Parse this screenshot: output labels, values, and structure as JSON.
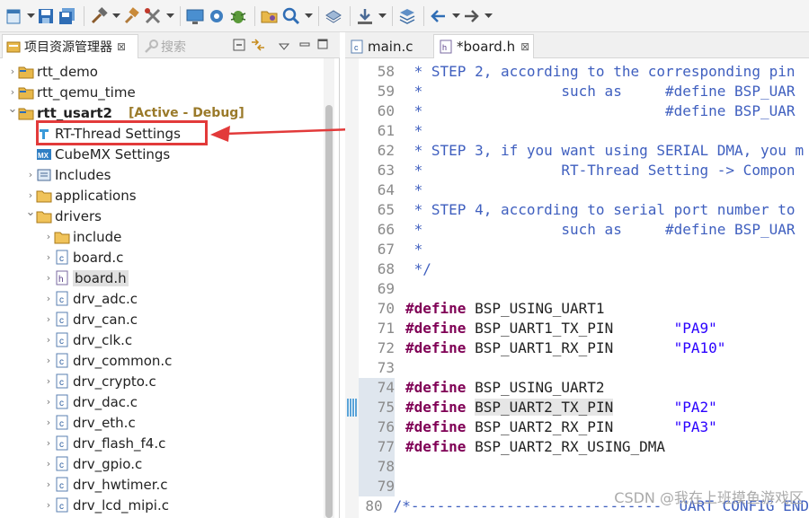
{
  "toolbar": {
    "icons": [
      "new-icon",
      "save-icon",
      "save-all-icon",
      "build-icon",
      "hammer-icon",
      "tools-icon",
      "monitor-icon",
      "gear-icon",
      "debug-bug-icon",
      "open-folder-icon",
      "search-icon",
      "layers-icon",
      "download-icon",
      "stack-icon",
      "back-arrow-icon",
      "forward-arrow-icon"
    ]
  },
  "left_panel": {
    "tabs": [
      {
        "label": "项目资源管理器",
        "close": "⊠"
      },
      {
        "label": "搜索"
      }
    ],
    "tree": [
      {
        "label": "rtt_demo",
        "icon": "project-icon",
        "depth": 0,
        "arrow": "›"
      },
      {
        "label": "rtt_qemu_time",
        "icon": "project-icon",
        "depth": 0,
        "arrow": "›"
      },
      {
        "label": "rtt_usart2",
        "icon": "project-icon",
        "depth": 0,
        "arrow": "⌄",
        "bold": true,
        "suffix": "[Active - Debug]"
      },
      {
        "label": "RT-Thread Settings",
        "icon": "rt-thread-icon",
        "depth": 1,
        "arrow": ""
      },
      {
        "label": "CubeMX Settings",
        "icon": "cubemx-icon",
        "depth": 1,
        "arrow": ""
      },
      {
        "label": "Includes",
        "icon": "includes-icon",
        "depth": 1,
        "arrow": "›"
      },
      {
        "label": "applications",
        "icon": "folder-icon",
        "depth": 1,
        "arrow": "›"
      },
      {
        "label": "drivers",
        "icon": "folder-icon",
        "depth": 1,
        "arrow": "⌄"
      },
      {
        "label": "include",
        "icon": "folder-icon",
        "depth": 2,
        "arrow": "›"
      },
      {
        "label": "board.c",
        "icon": "c-file-icon",
        "depth": 2,
        "arrow": "›"
      },
      {
        "label": "board.h",
        "icon": "h-file-icon",
        "depth": 2,
        "arrow": "›",
        "selected": true
      },
      {
        "label": "drv_adc.c",
        "icon": "c-file-icon",
        "depth": 2,
        "arrow": "›"
      },
      {
        "label": "drv_can.c",
        "icon": "c-file-icon",
        "depth": 2,
        "arrow": "›"
      },
      {
        "label": "drv_clk.c",
        "icon": "c-file-icon",
        "depth": 2,
        "arrow": "›"
      },
      {
        "label": "drv_common.c",
        "icon": "c-file-icon",
        "depth": 2,
        "arrow": "›"
      },
      {
        "label": "drv_crypto.c",
        "icon": "c-file-icon",
        "depth": 2,
        "arrow": "›"
      },
      {
        "label": "drv_dac.c",
        "icon": "c-file-icon",
        "depth": 2,
        "arrow": "›"
      },
      {
        "label": "drv_eth.c",
        "icon": "c-file-icon",
        "depth": 2,
        "arrow": "›"
      },
      {
        "label": "drv_flash_f4.c",
        "icon": "c-file-icon",
        "depth": 2,
        "arrow": "›"
      },
      {
        "label": "drv_gpio.c",
        "icon": "c-file-icon",
        "depth": 2,
        "arrow": "›"
      },
      {
        "label": "drv_hwtimer.c",
        "icon": "c-file-icon",
        "depth": 2,
        "arrow": "›"
      },
      {
        "label": "drv_lcd_mipi.c",
        "icon": "c-file-icon",
        "depth": 2,
        "arrow": "›"
      }
    ]
  },
  "editor": {
    "tabs": [
      {
        "label": "main.c",
        "active": false
      },
      {
        "label": "*board.h",
        "active": true,
        "close": "⊠"
      }
    ],
    "lines": [
      {
        "n": "58",
        "parts": [
          {
            "t": " * STEP 2, according to the corresponding pin",
            "c": "cm"
          }
        ]
      },
      {
        "n": "59",
        "parts": [
          {
            "t": " *                such as     #define BSP_UAR",
            "c": "cm"
          }
        ]
      },
      {
        "n": "60",
        "parts": [
          {
            "t": " *                            #define BSP_UAR",
            "c": "cm"
          }
        ]
      },
      {
        "n": "61",
        "parts": [
          {
            "t": " *",
            "c": "cm"
          }
        ]
      },
      {
        "n": "62",
        "parts": [
          {
            "t": " * STEP 3, if you want using SERIAL DMA, you m",
            "c": "cm"
          }
        ]
      },
      {
        "n": "63",
        "parts": [
          {
            "t": " *                RT-Thread Setting -> Compon",
            "c": "cm"
          }
        ]
      },
      {
        "n": "64",
        "parts": [
          {
            "t": " *",
            "c": "cm"
          }
        ]
      },
      {
        "n": "65",
        "parts": [
          {
            "t": " * STEP 4, according to serial port number to",
            "c": "cm"
          }
        ]
      },
      {
        "n": "66",
        "parts": [
          {
            "t": " *                such as     #define BSP_UAR",
            "c": "cm"
          }
        ]
      },
      {
        "n": "67",
        "parts": [
          {
            "t": " *",
            "c": "cm"
          }
        ]
      },
      {
        "n": "68",
        "parts": [
          {
            "t": " */",
            "c": "cm"
          }
        ]
      },
      {
        "n": "69",
        "parts": []
      },
      {
        "n": "70",
        "parts": [
          {
            "t": "#define",
            "c": "kw"
          },
          {
            "t": " BSP_USING_UART1",
            "c": ""
          }
        ]
      },
      {
        "n": "71",
        "parts": [
          {
            "t": "#define",
            "c": "kw"
          },
          {
            "t": " BSP_UART1_TX_PIN       ",
            "c": ""
          },
          {
            "t": "\"PA9\"",
            "c": "st"
          }
        ]
      },
      {
        "n": "72",
        "parts": [
          {
            "t": "#define",
            "c": "kw"
          },
          {
            "t": " BSP_UART1_RX_PIN       ",
            "c": ""
          },
          {
            "t": "\"PA10\"",
            "c": "st"
          }
        ]
      },
      {
        "n": "73",
        "parts": []
      },
      {
        "n": "74",
        "parts": [
          {
            "t": "#define",
            "c": "kw"
          },
          {
            "t": " BSP_USING_UART2",
            "c": ""
          }
        ],
        "hl": true
      },
      {
        "n": "75",
        "parts": [
          {
            "t": "#define",
            "c": "kw"
          },
          {
            "t": " ",
            "c": ""
          },
          {
            "t": "BSP_UART2_TX_PIN",
            "c": "sel"
          },
          {
            "t": "       ",
            "c": ""
          },
          {
            "t": "\"PA2\"",
            "c": "st"
          }
        ],
        "hl": true,
        "marker": true
      },
      {
        "n": "76",
        "parts": [
          {
            "t": "#define",
            "c": "kw"
          },
          {
            "t": " BSP_UART2_RX_PIN       ",
            "c": ""
          },
          {
            "t": "\"PA3\"",
            "c": "st"
          }
        ],
        "hl": true
      },
      {
        "n": "77",
        "parts": [
          {
            "t": "#define",
            "c": "kw"
          },
          {
            "t": " BSP_UART2_RX_USING_DMA",
            "c": ""
          }
        ],
        "hl": true
      },
      {
        "n": "78",
        "parts": [],
        "hl": true
      },
      {
        "n": "79",
        "parts": [],
        "hl": true
      },
      {
        "n": "80",
        "parts": [
          {
            "t": "/*-----------------------------  UART CONFIG END",
            "c": "cm"
          }
        ]
      }
    ]
  },
  "watermark": "CSDN @我在上班摸鱼游戏区"
}
